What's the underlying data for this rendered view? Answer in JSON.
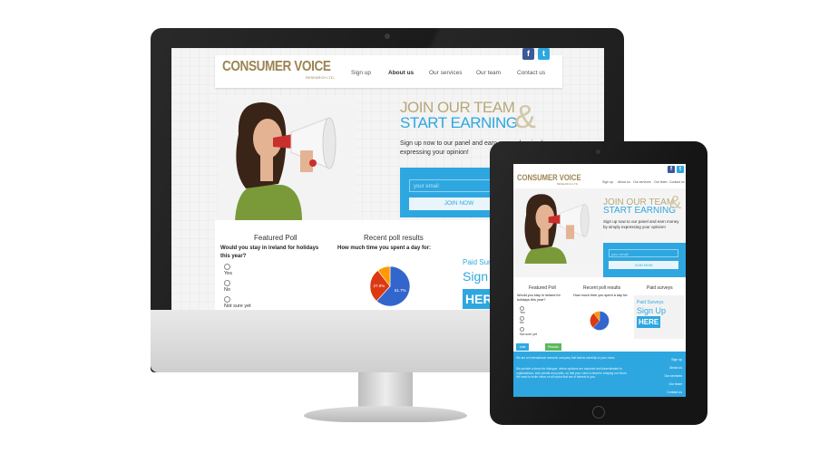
{
  "colors": {
    "brand_gold": "#9c8452",
    "accent_blue": "#2ea7e0",
    "pie_blue": "#3366cc",
    "pie_red": "#dc3912",
    "pie_orange": "#ff9900",
    "vote_green": "#5cb85c"
  },
  "brand": {
    "name": "CONSUMER VOICE",
    "sub": "RESEARCH LTD."
  },
  "nav": [
    "Sign up",
    "About us",
    "Our services",
    "Our team",
    "Contact us"
  ],
  "social": {
    "facebook": "f",
    "twitter": "t"
  },
  "hero": {
    "line1": "JOIN OUR TEAM",
    "line2": "START EARNING",
    "amp": "&",
    "text_desktop": "Sign up now to our panel and earn money by simply expressing your opinion!",
    "text_tablet": "Sign up now to our panel and earn money by simply expressing your opinion!",
    "email_placeholder": "your email",
    "join_label": "JOIN NOW"
  },
  "featured_poll": {
    "heading": "Featured Poll",
    "question": "Would you stay in ireland for holidays this year?",
    "options": [
      "Yes",
      "No",
      "Not sure yet"
    ],
    "vote_label": "Vote",
    "results_label": "Results"
  },
  "recent_poll": {
    "heading": "Recent poll results",
    "question": "How much time you spent a day for:"
  },
  "paid_surveys": {
    "heading": "Paid surveys",
    "line1": "Paid Surveys",
    "line2": "Sign Up",
    "line3": "HERE"
  },
  "footer": {
    "para1": "We are an international research company that listens carefully to your views.",
    "para2": "We provide a forum for dialogue, where opinions are captured and disseminated to organisations, both private and public, so that your voice is heard in shaping our future. We want to invite views on all topics that are of interest to you.",
    "links": [
      "Sign up",
      "About us",
      "Our services",
      "Our team",
      "Contact us"
    ]
  },
  "chart_data": {
    "type": "pie",
    "title": "",
    "slices": [
      {
        "value": 61.7,
        "label": "61.7%"
      },
      {
        "value": 27.9,
        "label": "27.9%"
      },
      {
        "value": 10.4,
        "label": ""
      }
    ]
  }
}
